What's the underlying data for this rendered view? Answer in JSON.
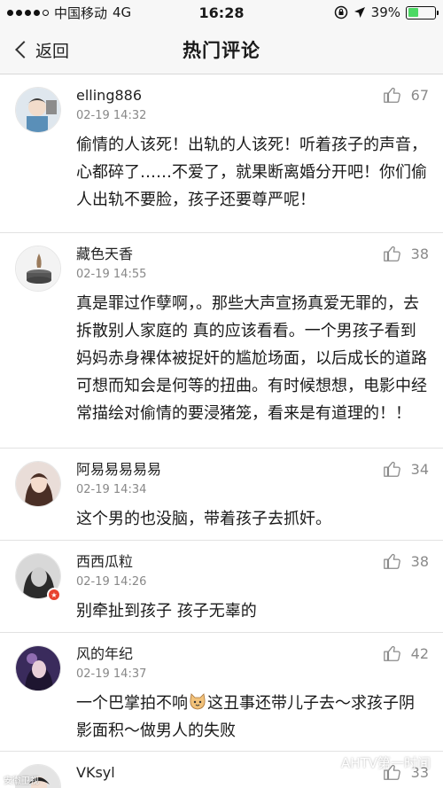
{
  "status_bar": {
    "carrier": "中国移动",
    "network": "4G",
    "time": "16:28",
    "battery_percent": "39%",
    "battery_level": 0.39
  },
  "nav": {
    "back_label": "返回",
    "title": "热门评论"
  },
  "comments": [
    {
      "username": "elling886",
      "time": "02-19 14:32",
      "likes": "67",
      "text": "偷情的人该死！出轨的人该死！听着孩子的声音，心都碎了……不爱了，就果断离婚分开吧！你们偷人出轨不要脸，孩子还要尊严呢！"
    },
    {
      "username": "藏色天香",
      "time": "02-19 14:55",
      "likes": "38",
      "text": "真是罪过作孽啊，。那些大声宣扬真爱无罪的，去拆散别人家庭的 真的应该看看。一个男孩子看到妈妈赤身裸体被捉奸的尴尬场面，以后成长的道路可想而知会是何等的扭曲。有时候想想，电影中经常描绘对偷情的要浸猪笼，看来是有道理的！！"
    },
    {
      "username": "阿易易易易易",
      "time": "02-19 14:34",
      "likes": "34",
      "text": "这个男的也没脑，带着孩子去抓奸。"
    },
    {
      "username": "西西瓜粒",
      "time": "02-19 14:26",
      "likes": "38",
      "text": "别牵扯到孩子 孩子无辜的"
    },
    {
      "username": "风的年纪",
      "time": "02-19 14:37",
      "likes": "42",
      "text_before": "一个巴掌拍不响",
      "text_after": "这丑事还带儿子去～求孩子阴影面积～做男人的失败"
    },
    {
      "username": "VKsyl",
      "likes": "33"
    }
  ],
  "watermark": {
    "text": "AHTV第一时间",
    "left_text": "安徽卫视"
  },
  "colors": {
    "nav_bg": "#f7f7f7",
    "divider": "#e2e2e2",
    "muted": "#888888",
    "battery_green": "#4cd964",
    "badge_red": "#e8422f"
  }
}
